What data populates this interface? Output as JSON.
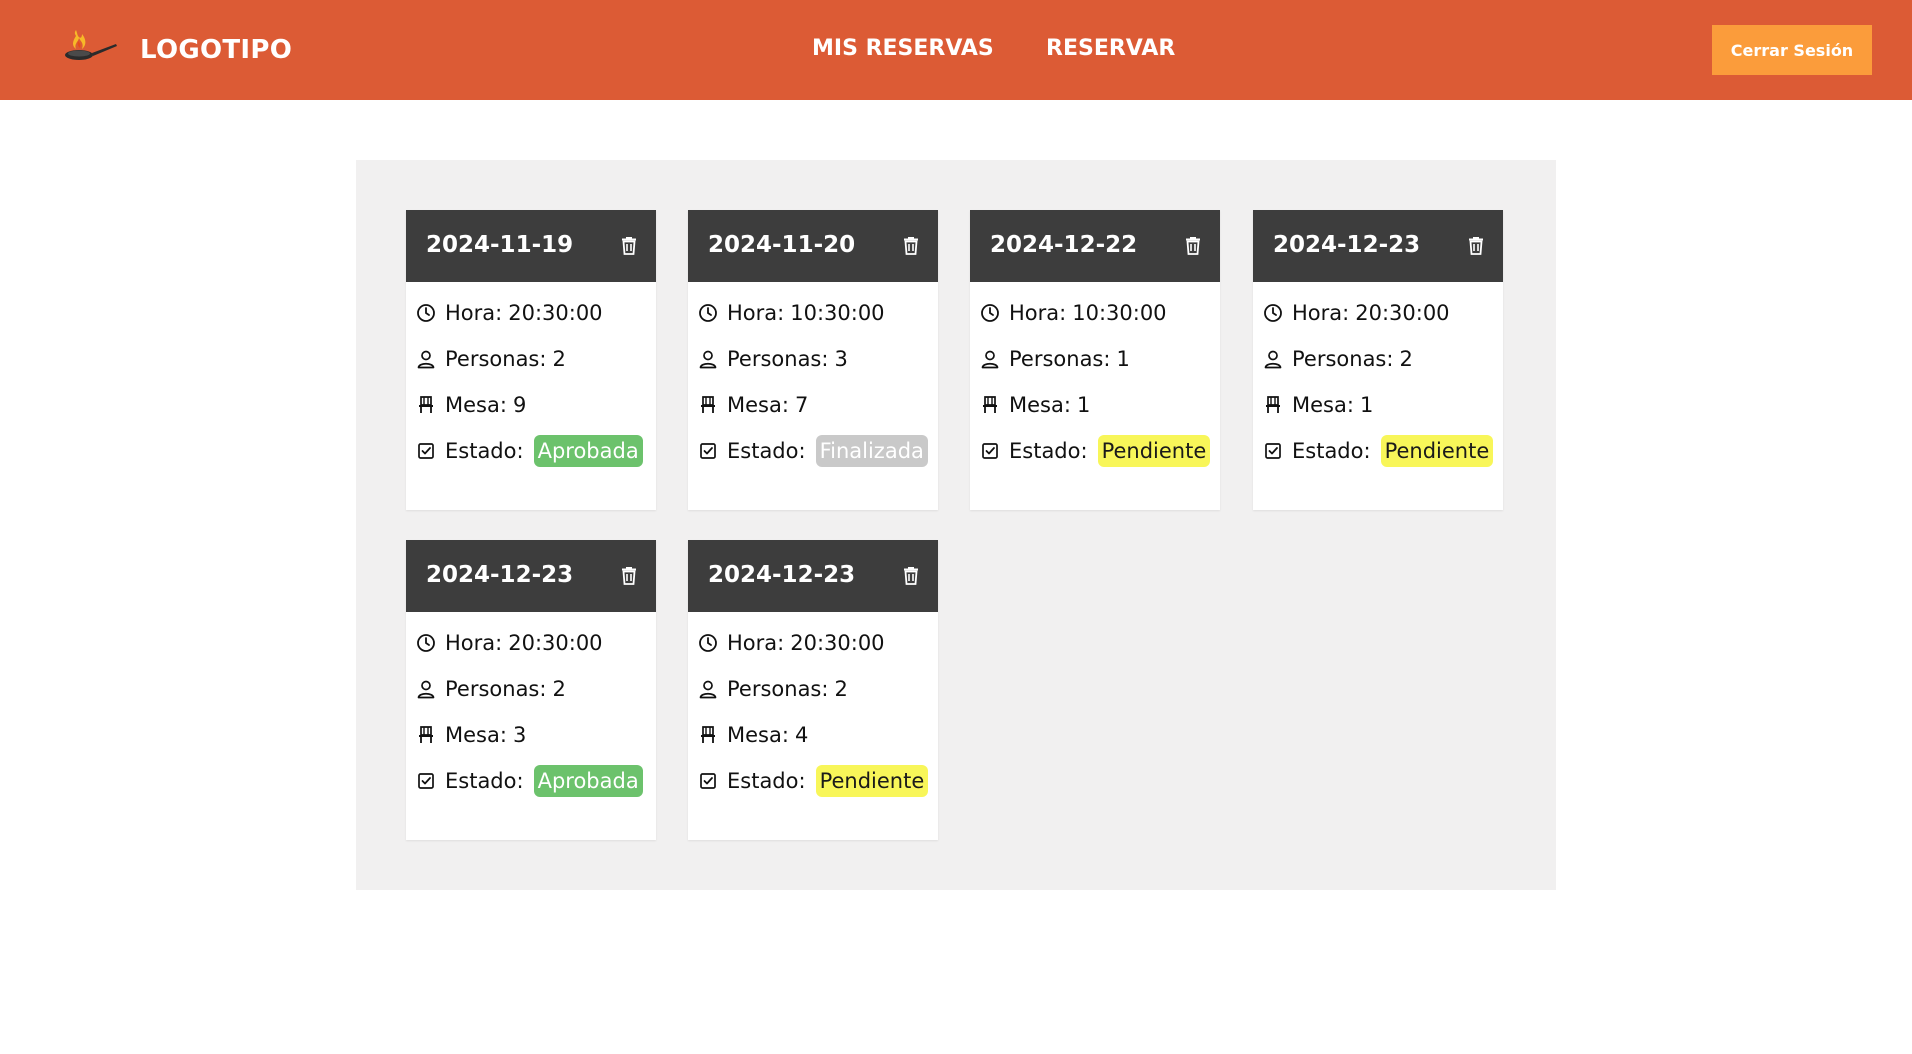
{
  "header": {
    "brand": "LOGOTIPO",
    "nav": [
      {
        "label": "MIS RESERVAS"
      },
      {
        "label": "RESERVAR"
      }
    ],
    "logout_label": "Cerrar Sesión"
  },
  "labels": {
    "hora": "Hora:",
    "personas": "Personas:",
    "mesa": "Mesa:",
    "estado": "Estado:"
  },
  "colors": {
    "navbar": "#dc5b35",
    "logout": "#fb9c3b",
    "card_header": "#3d3d3d",
    "status_aprobada": "#6cc26c",
    "status_finalizada": "#c9c9c9",
    "status_pendiente": "#f8f659"
  },
  "reservations": [
    {
      "date": "2024-11-19",
      "hora": "20:30:00",
      "personas": "2",
      "mesa": "9",
      "estado": "Aprobada"
    },
    {
      "date": "2024-11-20",
      "hora": "10:30:00",
      "personas": "3",
      "mesa": "7",
      "estado": "Finalizada"
    },
    {
      "date": "2024-12-22",
      "hora": "10:30:00",
      "personas": "1",
      "mesa": "1",
      "estado": "Pendiente"
    },
    {
      "date": "2024-12-23",
      "hora": "20:30:00",
      "personas": "2",
      "mesa": "1",
      "estado": "Pendiente"
    },
    {
      "date": "2024-12-23",
      "hora": "20:30:00",
      "personas": "2",
      "mesa": "3",
      "estado": "Aprobada"
    },
    {
      "date": "2024-12-23",
      "hora": "20:30:00",
      "personas": "2",
      "mesa": "4",
      "estado": "Pendiente"
    }
  ]
}
